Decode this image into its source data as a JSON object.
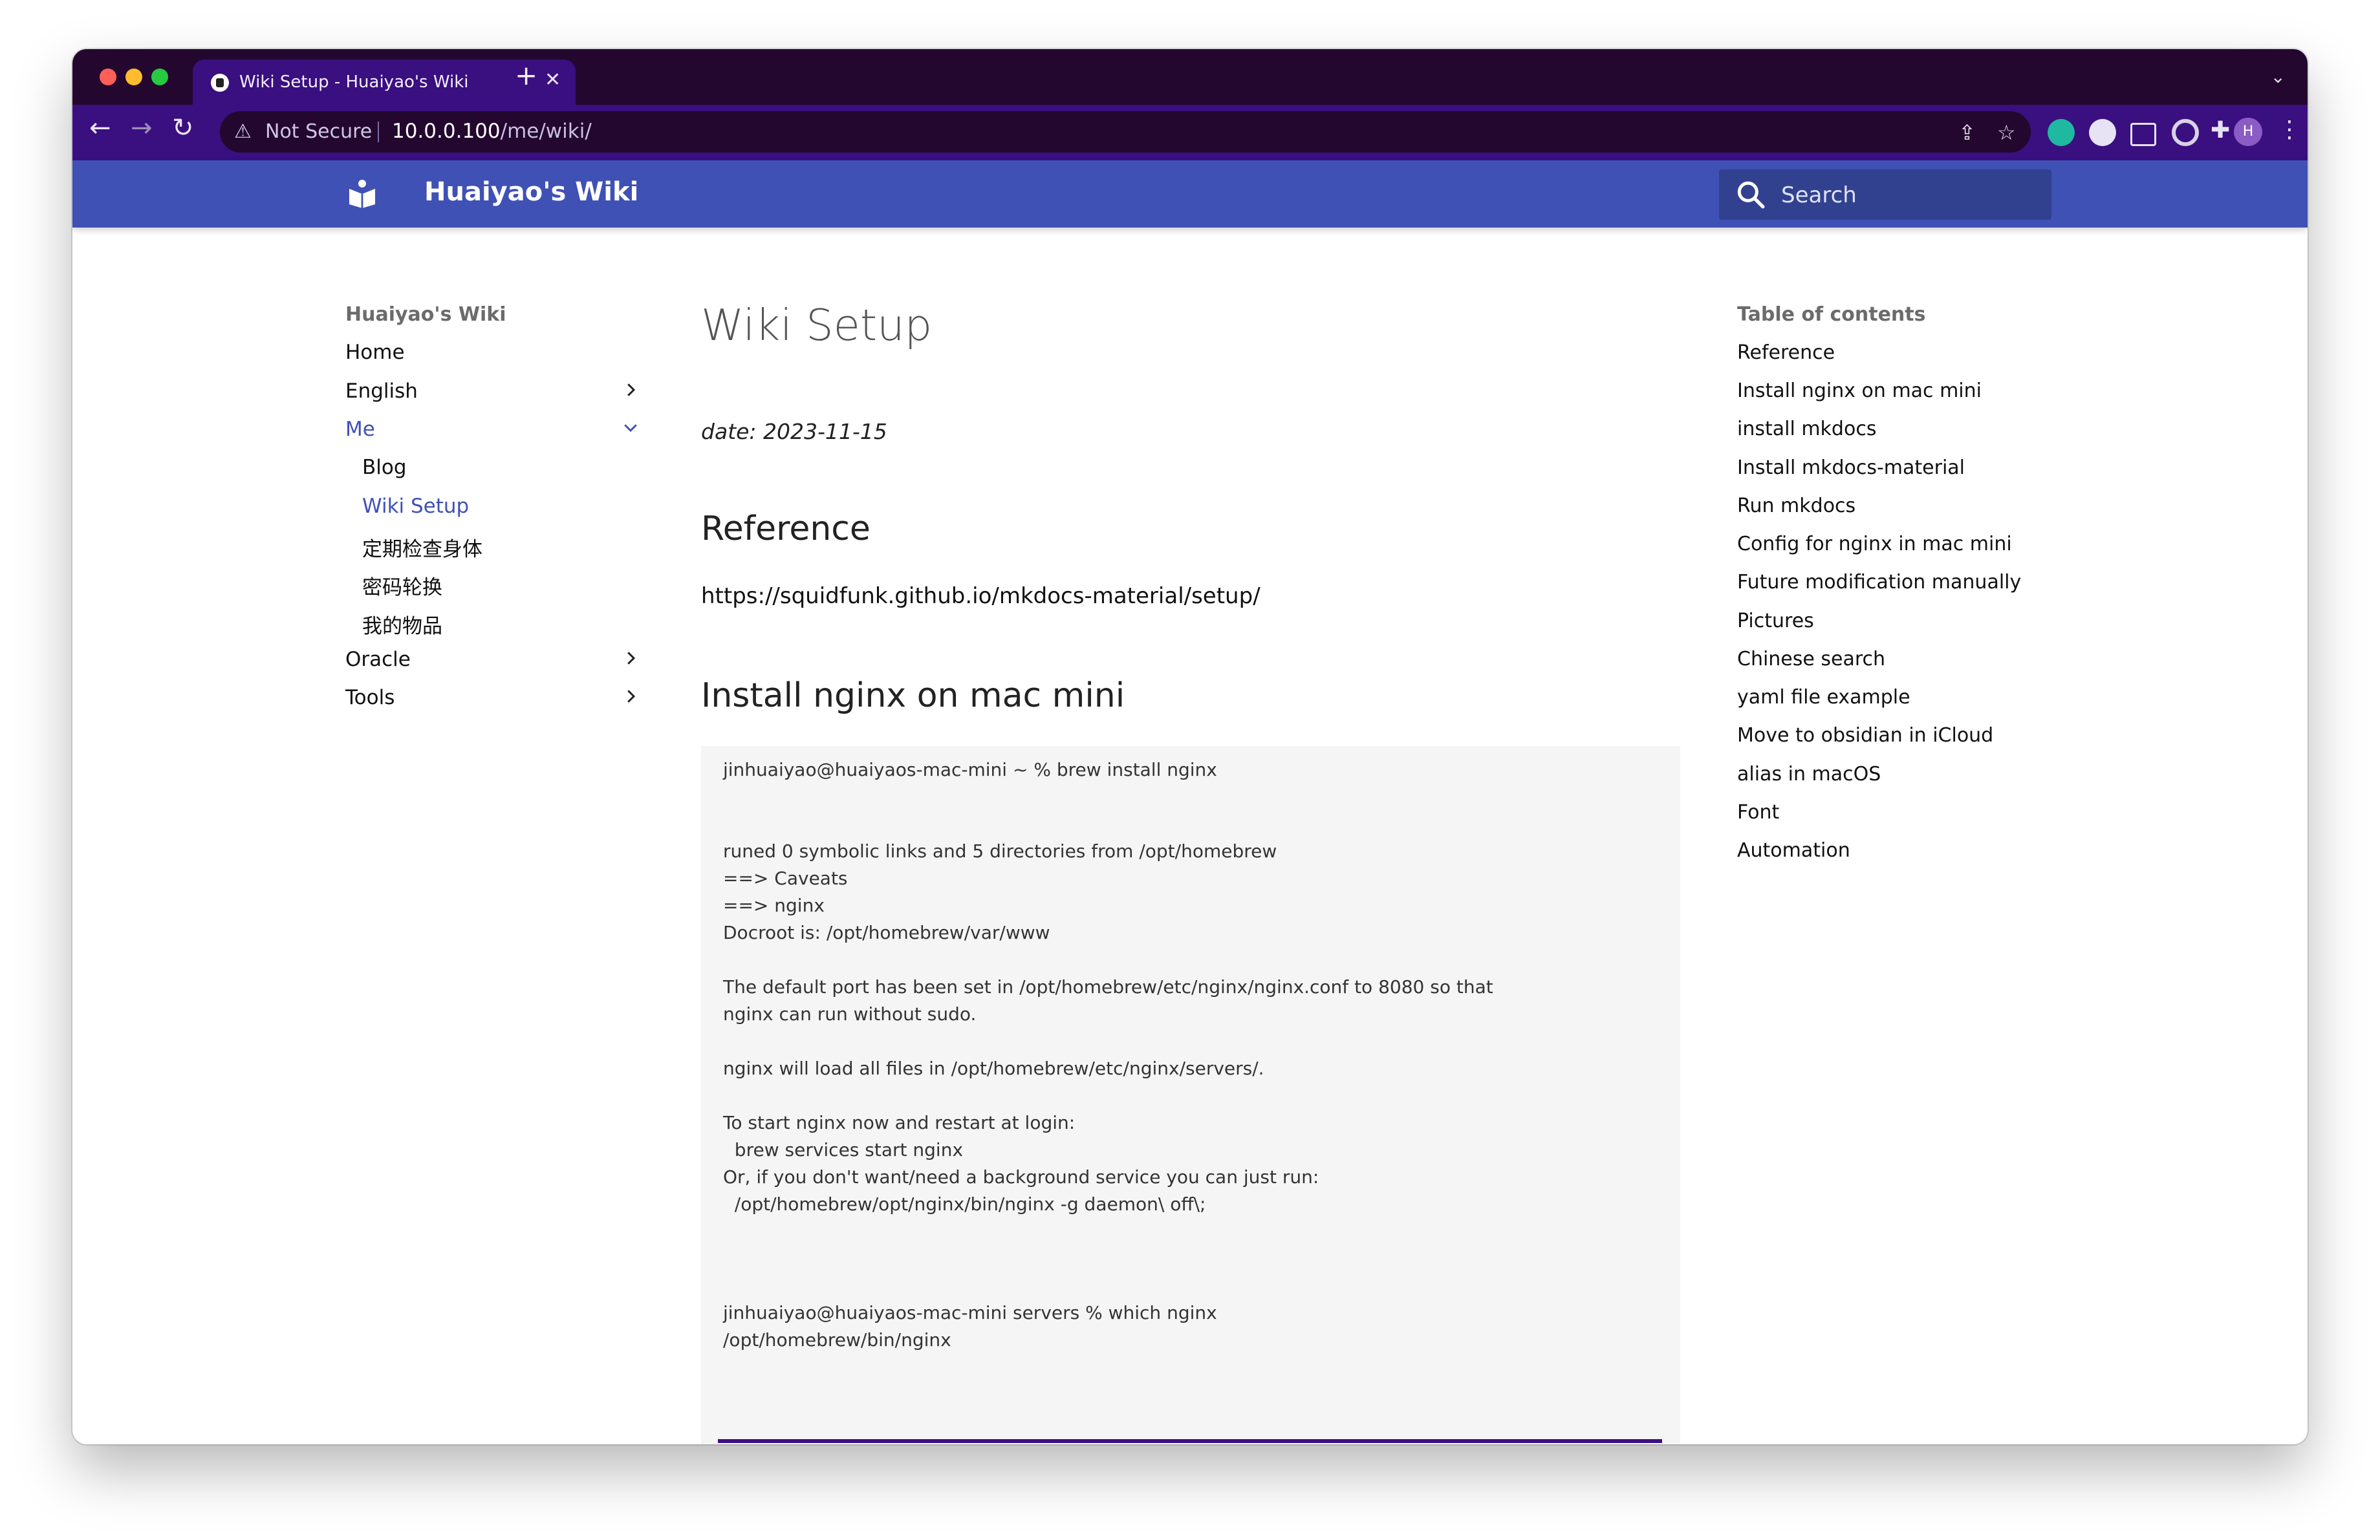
{
  "browser": {
    "tab_title": "Wiki Setup - Huaiyao's Wiki",
    "tab_close": "✕",
    "new_tab": "+",
    "not_secure": "Not Secure",
    "url_host": "10.0.0.100",
    "url_path": "/me/wiki/",
    "avatar_letter": "H",
    "icons": [
      "back-arrow-icon",
      "forward-arrow-icon",
      "reload-icon",
      "share-icon",
      "star-icon",
      "extensions-icon",
      "sidebar-icon",
      "kebab-menu-icon"
    ]
  },
  "header": {
    "title": "Huaiyao's Wiki",
    "search_placeholder": "Search",
    "color": "#3f51b5"
  },
  "nav": {
    "title": "Huaiyao's Wiki",
    "items": [
      {
        "label": "Home"
      },
      {
        "label": "English"
      },
      {
        "label": "Me"
      },
      {
        "label": "Blog"
      },
      {
        "label": "Wiki Setup"
      },
      {
        "label": "定期检查身体"
      },
      {
        "label": "密码轮换"
      },
      {
        "label": "我的物品"
      },
      {
        "label": "Oracle"
      },
      {
        "label": "Tools"
      }
    ]
  },
  "content": {
    "title": "Wiki Setup",
    "date": "date: 2023-11-15",
    "h_reference": "Reference",
    "reference_link": "https://squidfunk.github.io/mkdocs-material/setup/",
    "h_install": "Install nginx on mac mini",
    "code_lines": [
      "jinhuaiyao@huaiyaos-mac-mini ~ % brew install nginx",
      "runed 0 symbolic links and 5 directories from /opt/homebrew",
      "==> Caveats",
      "==> nginx",
      "Docroot is: /opt/homebrew/var/www",
      "The default port has been set in /opt/homebrew/etc/nginx/nginx.conf to 8080 so that",
      "nginx can run without sudo.",
      "nginx will load all files in /opt/homebrew/etc/nginx/servers/.",
      "To start nginx now and restart at login:",
      "  brew services start nginx",
      "Or, if you don't want/need a background service you can just run:",
      "  /opt/homebrew/opt/nginx/bin/nginx -g daemon\\ off\\;",
      "jinhuaiyao@huaiyaos-mac-mini servers % which nginx",
      "/opt/homebrew/bin/nginx"
    ]
  },
  "toc": {
    "title": "Table of contents",
    "items": [
      "Reference",
      "Install nginx on mac mini",
      "install mkdocs",
      "Install mkdocs-material",
      "Run mkdocs",
      "Config for nginx in mac mini",
      "Future modification manually",
      "Pictures",
      "Chinese search",
      "yaml file example",
      "Move to obsidian in iCloud",
      "alias in macOS",
      "Font",
      "Automation"
    ]
  }
}
